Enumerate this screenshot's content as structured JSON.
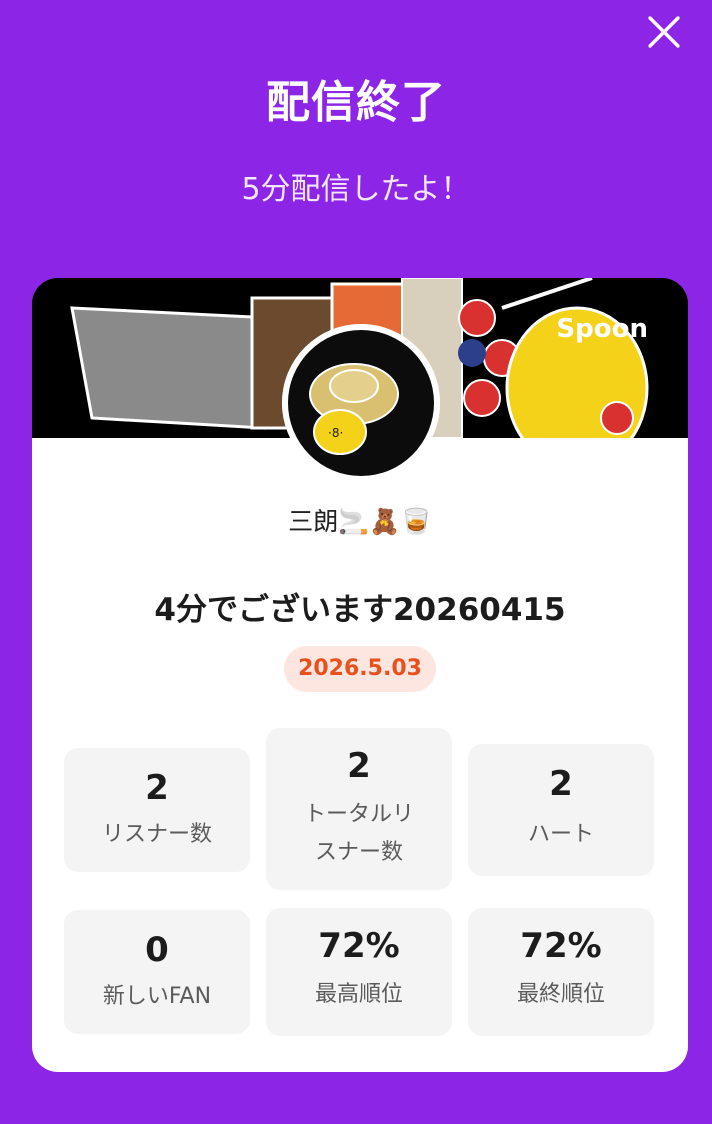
{
  "header": {
    "title": "配信終了",
    "subtitle": "5分配信したよ！",
    "close_icon": "close-icon"
  },
  "card": {
    "brand": "Spoon",
    "username": "三朗🚬🧸🥃",
    "stream_title": "4分でございます20260415",
    "date": "2026.5.03",
    "stats": [
      {
        "value": "2",
        "label": "リスナー数"
      },
      {
        "value": "2",
        "label": "トータルリスナー数"
      },
      {
        "value": "2",
        "label": "ハート"
      },
      {
        "value": "0",
        "label": "新しいFAN"
      },
      {
        "value": "72%",
        "label": "最高順位"
      },
      {
        "value": "72%",
        "label": "最終順位"
      }
    ]
  },
  "colors": {
    "background": "#8d25e6",
    "date_badge_bg": "#fde6e0",
    "date_badge_text": "#e8501c"
  }
}
